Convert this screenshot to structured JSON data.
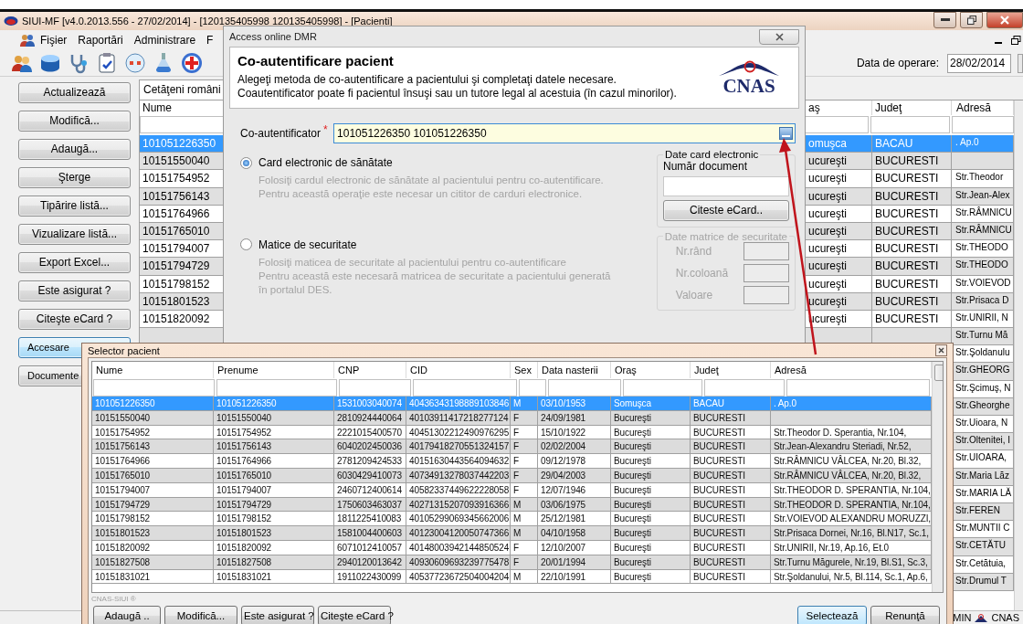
{
  "window": {
    "title": "SIUI-MF [v4.0.2013.556 - 27/02/2014] - [120135405998 120135405998] - [Pacienti]"
  },
  "menu": [
    "Fişier",
    "Raportări",
    "Administrare",
    "F"
  ],
  "toolbar": {
    "date_label": "Data de operare:",
    "date_value": "28/02/2014"
  },
  "side_buttons": [
    {
      "label": "Actualizează",
      "focused": false
    },
    {
      "label": "Modifică...",
      "focused": false
    },
    {
      "label": "Adaugă...",
      "focused": false
    },
    {
      "label": "Şterge",
      "focused": false
    },
    {
      "label": "Tipărire listă...",
      "focused": false
    },
    {
      "label": "Vizualizare listă...",
      "focused": false
    },
    {
      "label": "Export Excel...",
      "focused": false
    },
    {
      "label": "Este asigurat ?",
      "focused": false
    },
    {
      "label": "Citeşte eCard ?",
      "focused": false
    },
    {
      "label": "Accesare",
      "focused": true
    },
    {
      "label": "Documente",
      "focused": false
    }
  ],
  "main_table": {
    "tab": "Cetăţeni români",
    "columns": {
      "nume": "Nume",
      "oras": "aş",
      "judet": "Judeţ",
      "adresa": "Adresă"
    },
    "rows": [
      {
        "nume": "101051226350",
        "oras": "omuşca",
        "judet": "BACAU",
        "adresa": ". Ap.0",
        "selected": true
      },
      {
        "nume": "10151550040",
        "oras": "ucureşti",
        "judet": "BUCURESTI",
        "selected": false
      },
      {
        "nume": "10151754952",
        "oras": "ucureşti",
        "judet": "BUCURESTI",
        "adresa": "Str.Theodor",
        "selected": false
      },
      {
        "nume": "10151756143",
        "oras": "ucureşti",
        "judet": "BUCURESTI",
        "adresa": "Str.Jean-Alex",
        "selected": false
      },
      {
        "nume": "10151764966",
        "oras": "ucureşti",
        "judet": "BUCURESTI",
        "adresa": "Str.RÂMNICU",
        "selected": false
      },
      {
        "nume": "10151765010",
        "oras": "ucureşti",
        "judet": "BUCURESTI",
        "adresa": "Str.RÂMNICU",
        "selected": false
      },
      {
        "nume": "10151794007",
        "oras": "ucureşti",
        "judet": "BUCURESTI",
        "adresa": "Str.THEODO",
        "selected": false
      },
      {
        "nume": "10151794729",
        "oras": "ucureşti",
        "judet": "BUCURESTI",
        "adresa": "Str.THEODO",
        "selected": false
      },
      {
        "nume": "10151798152",
        "oras": "ucureşti",
        "judet": "BUCURESTI",
        "adresa": "Str.VOIEVOD",
        "selected": false
      },
      {
        "nume": "10151801523",
        "oras": "ucureşti",
        "judet": "BUCURESTI",
        "adresa": "Str.Prisaca D",
        "selected": false
      },
      {
        "nume": "10151820092",
        "oras": "ucureşti",
        "judet": "BUCURESTI",
        "adresa": "Str.UNIRII, N",
        "selected": false
      },
      {
        "adresa": "Str.Turnu Mă",
        "selected": false
      },
      {
        "adresa": "Str.Şoldanulu",
        "selected": false
      },
      {
        "adresa": "Str.GHEORG",
        "selected": false
      },
      {
        "adresa": "Str.Şcimuş, N",
        "selected": false
      },
      {
        "adresa": "Str.Gheorghe",
        "selected": false
      },
      {
        "adresa": "Str.Uioara, N",
        "selected": false
      },
      {
        "adresa": "Str.Oltenitei, I",
        "selected": false
      },
      {
        "adresa": "Str.UIOARA,",
        "selected": false
      },
      {
        "adresa": "Str.Maria Lăz",
        "selected": false
      },
      {
        "adresa": "Str.MARIA LĂ",
        "selected": false
      },
      {
        "adresa": "Str.FEREN",
        "selected": false
      },
      {
        "adresa": "Str.MUNTII C",
        "selected": false
      },
      {
        "adresa": "Str.CETĂTU",
        "selected": false
      },
      {
        "adresa": "Str.Cetătuia,",
        "selected": false
      },
      {
        "adresa": "Str.Drumul T",
        "selected": false
      }
    ]
  },
  "status_bar": {
    "items": [
      "MIN",
      "CNAS"
    ]
  },
  "dmr_dialog": {
    "title": "Access online DMR",
    "heading": "Co-autentificare pacient",
    "intro": [
      "Alegeţi metoda de co-autentificare a pacientului şi completaţi datele necesare.",
      "Coautentificator poate fi pacientul însuşi sau un tutore legal al acestuia (în cazul minorilor)."
    ],
    "logo": "CNAS",
    "coauth_label": "Co-autentificator",
    "required_mark": "*",
    "coauth_value": "101051226350 101051226350",
    "methods": [
      {
        "label": "Card electronic de sănătate",
        "selected": true,
        "description": [
          "Folosiţi cardul electronic de sănătate al pacientului pentru co-autentificare.",
          "Pentru această operaţie este necesar un cititor de carduri electronice."
        ],
        "group": {
          "kind": "card",
          "title": "Date card electronic",
          "disabled": false,
          "fields": [
            "Număr document"
          ],
          "button": "Citeste eCard.."
        }
      },
      {
        "label": "Matice de securitate",
        "selected": false,
        "description": [
          "Folosiţi maticea de securitate al pacientului pentru co-autentificare",
          "Pentru această este necesară matricea de securitate a pacientului generată",
          "în portalul DES."
        ],
        "group": {
          "kind": "matrix",
          "title": "Date matrice de securitate",
          "disabled": true,
          "fields": [
            "Nr.rând",
            "Nr.coloană",
            "Valoare"
          ]
        }
      }
    ]
  },
  "selector_dialog": {
    "title": "Selector pacient",
    "columns": [
      "Nume",
      "Prenume",
      "CNP",
      "CID",
      "Sex",
      "Data nasterii",
      "Oraş",
      "Judeţ",
      "Adresă"
    ],
    "rows": [
      {
        "cells": [
          "101051226350",
          "101051226350",
          "1531003040074",
          "40436343198889103846",
          "M",
          "03/10/1953",
          "Somuşca",
          "BACAU",
          ". Ap.0"
        ],
        "selected": true
      },
      {
        "cells": [
          "10151550040",
          "10151550040",
          "2810924440064",
          "40103911417218277124",
          "F",
          "24/09/1981",
          "Bucureşti",
          "BUCURESTI",
          ""
        ],
        "selected": false
      },
      {
        "cells": [
          "10151754952",
          "10151754952",
          "2221015400570",
          "40451302212490976295",
          "F",
          "15/10/1922",
          "Bucureşti",
          "BUCURESTI",
          "Str.Theodor D. Sperantia, Nr.104,"
        ],
        "selected": false
      },
      {
        "cells": [
          "10151756143",
          "10151756143",
          "6040202450036",
          "40179418270551324157",
          "F",
          "02/02/2004",
          "Bucureşti",
          "BUCURESTI",
          "Str.Jean-Alexandru Steriadi, Nr.52,"
        ],
        "selected": false
      },
      {
        "cells": [
          "10151764966",
          "10151764966",
          "2781209424533",
          "40151630443564094632",
          "F",
          "09/12/1978",
          "Bucureşti",
          "BUCURESTI",
          "Str.RÂMNICU VÂLCEA, Nr.20, Bl.32,"
        ],
        "selected": false
      },
      {
        "cells": [
          "10151765010",
          "10151765010",
          "6030429410073",
          "40734913278037442203",
          "F",
          "29/04/2003",
          "Bucureşti",
          "BUCURESTI",
          "Str.RÂMNICU VÂLCEA, Nr.20, Bl.32,"
        ],
        "selected": false
      },
      {
        "cells": [
          "10151794007",
          "10151794007",
          "2460712400614",
          "40582337449622228058",
          "F",
          "12/07/1946",
          "Bucureşti",
          "BUCURESTI",
          "Str.THEODOR D. SPERANTIA, Nr.104,"
        ],
        "selected": false
      },
      {
        "cells": [
          "10151794729",
          "10151794729",
          "1750603463037",
          "40271315207093916366",
          "M",
          "03/06/1975",
          "Bucureşti",
          "BUCURESTI",
          "Str.THEODOR D. SPERANTIA, Nr.104,"
        ],
        "selected": false
      },
      {
        "cells": [
          "10151798152",
          "10151798152",
          "1811225410083",
          "40105299069345662006",
          "M",
          "25/12/1981",
          "Bucureşti",
          "BUCURESTI",
          "Str.VOIEVOD ALEXANDRU MORUZZI,"
        ],
        "selected": false
      },
      {
        "cells": [
          "10151801523",
          "10151801523",
          "1581004400603",
          "40123004120050747366",
          "M",
          "04/10/1958",
          "Bucureşti",
          "BUCURESTI",
          "Str.Prisaca Dornei, Nr.16, Bl.N17, Sc.1,"
        ],
        "selected": false
      },
      {
        "cells": [
          "10151820092",
          "10151820092",
          "6071012410057",
          "40148003942144850524",
          "F",
          "12/10/2007",
          "Bucureşti",
          "BUCURESTI",
          "Str.UNIRII, Nr.19, Ap.16, Et.0"
        ],
        "selected": false
      },
      {
        "cells": [
          "10151827508",
          "10151827508",
          "2940120013642",
          "40930609693239775478",
          "F",
          "20/01/1994",
          "Bucureşti",
          "BUCURESTI",
          "Str.Turnu Măgurele, Nr.19, Bl.S1, Sc.3,"
        ],
        "selected": false
      },
      {
        "cells": [
          "10151831021",
          "10151831021",
          "1911022430099",
          "40537723672504004204",
          "M",
          "22/10/1991",
          "Bucureşti",
          "BUCURESTI",
          "Str.Şoldanului, Nr.5, Bl.114, Sc.1, Ap.6,"
        ],
        "selected": false
      }
    ],
    "brand": "CNAS-SIUI ®",
    "buttons": [
      {
        "label": "Adaugă ..",
        "default": false
      },
      {
        "label": "Modifică...",
        "default": false
      },
      {
        "label": "Este asigurat ?",
        "default": false
      },
      {
        "label": "Citeşte eCard ?",
        "default": false
      }
    ],
    "actions": [
      {
        "label": "Selectează",
        "default": true
      },
      {
        "label": "Renunţă",
        "default": false
      }
    ]
  }
}
